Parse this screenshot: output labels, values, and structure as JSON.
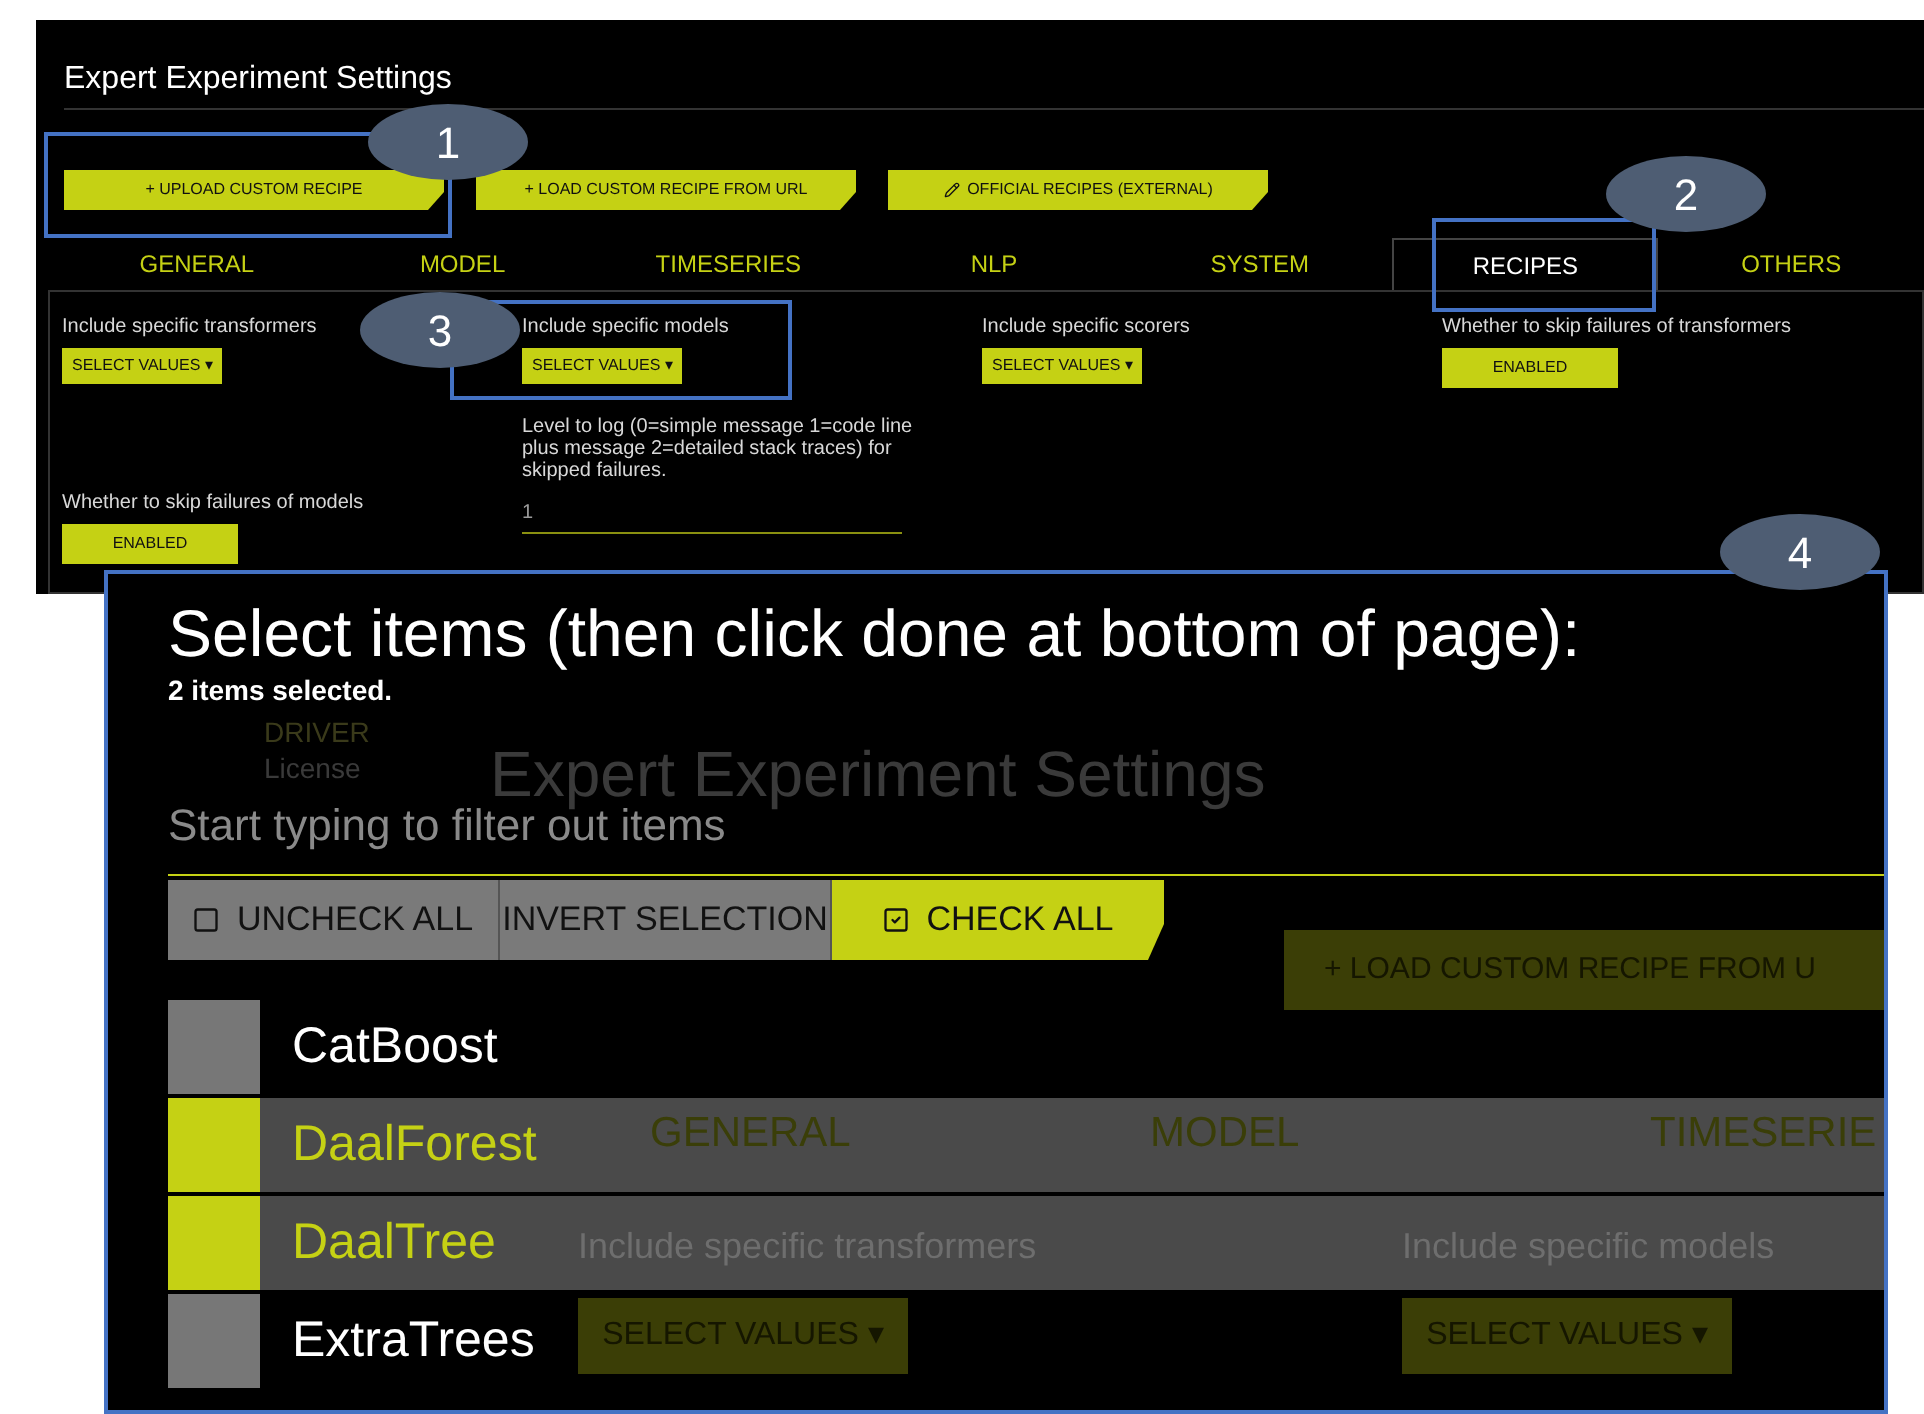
{
  "settings_panel": {
    "title": "Expert Experiment Settings",
    "recipe_buttons": [
      {
        "label": "+ UPLOAD CUSTOM RECIPE",
        "kind": "upload"
      },
      {
        "label": "+ LOAD CUSTOM RECIPE FROM URL",
        "kind": "url"
      },
      {
        "label": "OFFICIAL RECIPES (EXTERNAL)",
        "kind": "external"
      }
    ],
    "tabs": [
      {
        "label": "GENERAL",
        "selected": false
      },
      {
        "label": "MODEL",
        "selected": false
      },
      {
        "label": "TIMESERIES",
        "selected": false
      },
      {
        "label": "NLP",
        "selected": false
      },
      {
        "label": "SYSTEM",
        "selected": false
      },
      {
        "label": "RECIPES",
        "selected": true
      },
      {
        "label": "OTHERS",
        "selected": false
      }
    ],
    "fields": [
      {
        "kind": "select",
        "label": "Include specific transformers",
        "value": "SELECT VALUES ▾"
      },
      {
        "kind": "select",
        "label": "Include specific models",
        "value": "SELECT VALUES ▾"
      },
      {
        "kind": "select",
        "label": "Include specific scorers",
        "value": "SELECT VALUES ▾"
      },
      {
        "kind": "toggle",
        "label": "Whether to skip failures of transformers",
        "value": "ENABLED"
      },
      {
        "kind": "toggle",
        "label": "Whether to skip failures of models",
        "value": "ENABLED"
      },
      {
        "kind": "input",
        "label": "Level to log (0=simple message 1=code line plus message 2=detailed stack traces) for skipped failures.",
        "value": "1"
      }
    ]
  },
  "annotations": [
    {
      "number": "1"
    },
    {
      "number": "2"
    },
    {
      "number": "3"
    },
    {
      "number": "4"
    }
  ],
  "select_dialog": {
    "title": "Select items (then click done at bottom of page):",
    "count": "2 items selected.",
    "background_ghost": {
      "side_labels": [
        "DRIVER",
        "License"
      ],
      "title": "Expert Experiment Settings",
      "button": "+ LOAD CUSTOM RECIPE FROM U",
      "tabs": [
        "GENERAL",
        "MODEL",
        "TIMESERIE"
      ],
      "labels": [
        "Include specific transformers",
        "Include specific models"
      ],
      "selects": [
        "SELECT VALUES ▾",
        "SELECT VALUES ▾"
      ]
    },
    "filter": {
      "placeholder": "Start typing to filter out items"
    },
    "actions": [
      {
        "kind": "uncheck",
        "label": "UNCHECK ALL",
        "highlighted": false
      },
      {
        "kind": "invert",
        "label": "INVERT SELECTION",
        "highlighted": false
      },
      {
        "kind": "check",
        "label": "CHECK ALL",
        "highlighted": true
      }
    ],
    "items": [
      {
        "label": "CatBoost",
        "checked": false
      },
      {
        "label": "DaalForest",
        "checked": true
      },
      {
        "label": "DaalTree",
        "checked": true
      },
      {
        "label": "ExtraTrees",
        "checked": false
      }
    ]
  }
}
